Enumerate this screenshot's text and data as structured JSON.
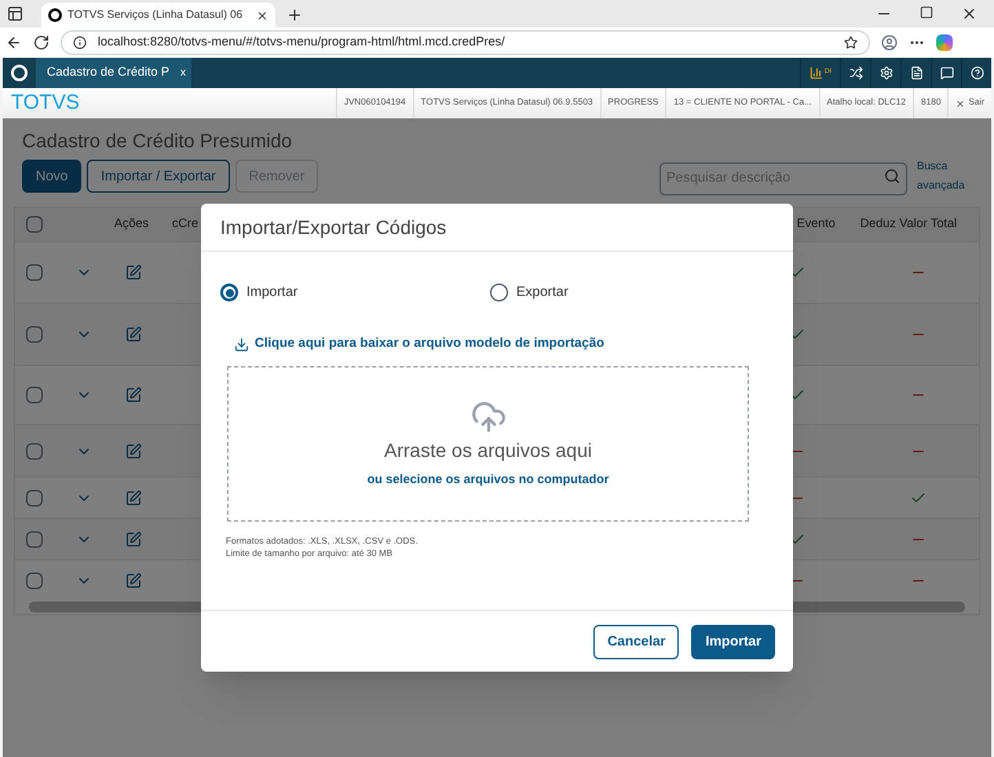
{
  "browser": {
    "tab_title": "TOTVS Serviços (Linha Datasul) 06",
    "url": "localhost:8280/totvs-menu/#/totvs-menu/program-html/html.mcd.credPres/"
  },
  "app_bar": {
    "tab_label": "Cadastro de Crédito P",
    "tab_close": "x",
    "signal_label": "DI"
  },
  "info_bar": {
    "logo": "TOTVS",
    "items": [
      "JVN060104194",
      "TOTVS Serviços (Linha Datasul) 06.9.5503",
      "PROGRESS",
      "13 = CLIENTE NO PORTAL - Ca...",
      "Atalho local: DLC12",
      "8180"
    ],
    "exit": "Sair"
  },
  "page": {
    "title": "Cadastro de Crédito Presumido",
    "buttons": [
      {
        "label": "Novo",
        "kind": "primary"
      },
      {
        "label": "Importar / Exportar",
        "kind": "secondary"
      },
      {
        "label": "Remover",
        "kind": "disabled"
      }
    ],
    "search_placeholder": "Pesquisar descrição",
    "advanced_search": "Busca avançada"
  },
  "table": {
    "columns": [
      "Ações",
      "cCre",
      "Evento",
      "Deduz Valor Total"
    ],
    "all_checked": false,
    "rows": [
      {
        "checked": false,
        "evento": true,
        "deduz": false
      },
      {
        "checked": false,
        "evento": true,
        "deduz": false
      },
      {
        "checked": false,
        "evento": true,
        "deduz": false
      },
      {
        "checked": false,
        "evento": false,
        "deduz": false
      },
      {
        "checked": false,
        "evento": false,
        "deduz": true
      },
      {
        "checked": false,
        "evento": true,
        "deduz": false
      },
      {
        "checked": false,
        "evento": false,
        "deduz": false
      }
    ]
  },
  "dialog": {
    "title": "Importar/Exportar Códigos",
    "options": [
      {
        "label": "Importar",
        "selected": true
      },
      {
        "label": "Exportar",
        "selected": false
      }
    ],
    "download_link": "Clique aqui para baixar o arquivo modelo de importação",
    "dropzone": {
      "title": "Arraste os arquivos aqui",
      "link": "ou selecione os arquivos no computador"
    },
    "notes": [
      "Formatos adotados: .XLS, .XLSX, .CSV e .ODS.",
      "Limite de tamanho por arquivo: até 30 MB"
    ],
    "buttons": [
      {
        "label": "Cancelar",
        "kind": "secondary"
      },
      {
        "label": "Importar",
        "kind": "primary"
      }
    ]
  }
}
